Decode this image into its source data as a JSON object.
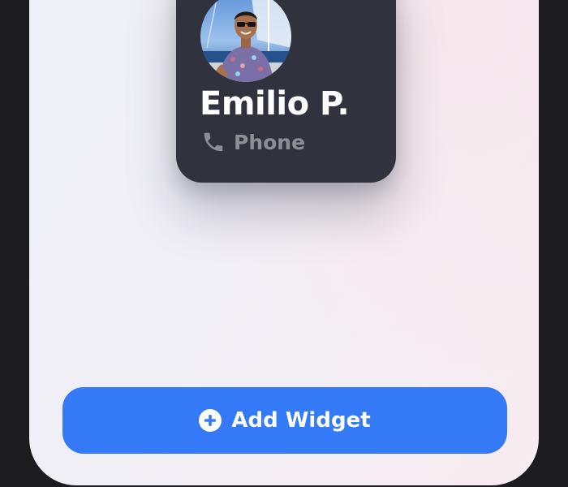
{
  "widget": {
    "contact_name": "Emilio P.",
    "service_label": "Phone",
    "service_icon": "phone-icon",
    "avatar_icon": "contact-photo"
  },
  "add_button": {
    "label": "Add Widget",
    "icon": "plus-circle-icon",
    "color": "#3479f6"
  },
  "colors": {
    "widget_background": "#30333d",
    "device_frame": "#1c1c1e",
    "secondary_text": "#8e8f96"
  }
}
